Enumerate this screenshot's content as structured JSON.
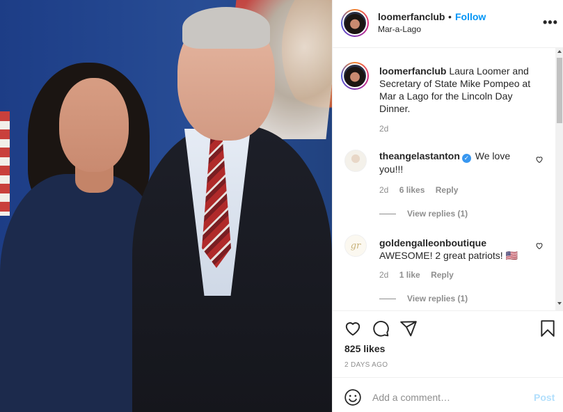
{
  "header": {
    "username": "loomerfanclub",
    "separator": "•",
    "follow_label": "Follow",
    "location": "Mar-a-Lago",
    "more_label": "•••"
  },
  "caption": {
    "username": "loomerfanclub",
    "text": "Laura Loomer and Secretary of State Mike Pompeo at Mar a Lago for the Lincoln Day Dinner.",
    "time": "2d"
  },
  "comments": [
    {
      "username": "theangelastanton",
      "verified": true,
      "text": "We love you!!!",
      "time": "2d",
      "likes": "6 likes",
      "reply_label": "Reply",
      "view_replies": "View replies (1)"
    },
    {
      "username": "goldengalleonboutique",
      "verified": false,
      "text": "AWESOME! 2 great patriots! 🇺🇸",
      "time": "2d",
      "likes": "1 like",
      "reply_label": "Reply",
      "view_replies": "View replies (1)"
    }
  ],
  "actions": {
    "icons": [
      "heart-icon",
      "comment-icon",
      "share-icon",
      "bookmark-icon"
    ],
    "likes": "825 likes",
    "date": "2 DAYS AGO"
  },
  "add_comment": {
    "placeholder": "Add a comment…",
    "post_label": "Post"
  },
  "colors": {
    "link_blue": "#0095f6",
    "muted": "#8e8e8e",
    "post_disabled": "#b2dffc",
    "text": "#262626"
  }
}
